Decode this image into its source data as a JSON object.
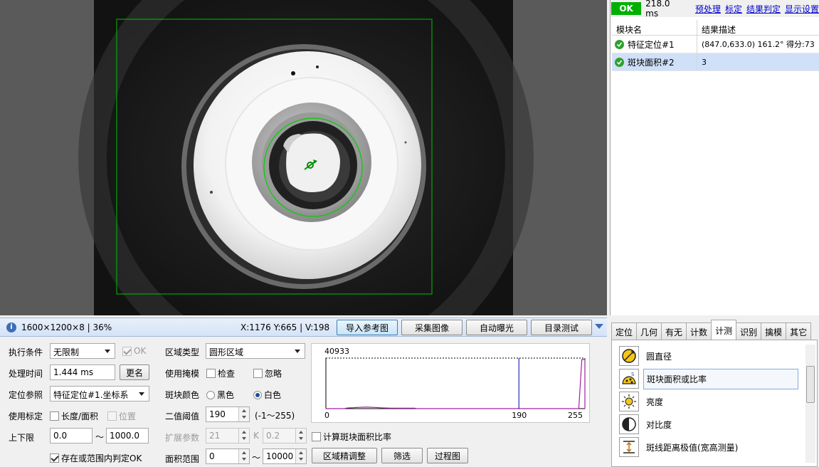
{
  "status": {
    "ok_label": "OK",
    "time": "218.0 ms",
    "menu": [
      "预处理",
      "标定",
      "结果判定",
      "显示设置"
    ]
  },
  "results": {
    "headers": [
      "模块名",
      "结果描述"
    ],
    "rows": [
      {
        "name": "特征定位#1",
        "desc": "(847.0,633.0) 161.2° 得分:73"
      },
      {
        "name": "斑块面积#2",
        "desc": "3"
      }
    ]
  },
  "image_bar": {
    "image_info": "1600×1200×8 | 36%",
    "pixel_info": "X:1176 Y:665 | V:198",
    "buttons": [
      "导入参考图",
      "采集图像",
      "自动曝光",
      "目录测试"
    ]
  },
  "params": {
    "exec_cond_label": "执行条件",
    "exec_cond_value": "无限制",
    "ok_label": "OK",
    "proc_time_label": "处理时间",
    "proc_time_value": "1.444 ms",
    "rename_label": "更名",
    "loc_ref_label": "定位参照",
    "loc_ref_value": "特征定位#1.坐标系",
    "use_calib_label": "使用标定",
    "length_area_label": "长度/面积",
    "position_label": "位置",
    "limits_label": "上下限",
    "lower_value": "0.0",
    "tilde": "～",
    "upper_value": "1000.0",
    "exist_ok_label": "存在或范围内判定OK",
    "region_type_label": "区域类型",
    "region_type_value": "圆形区域",
    "use_mask_label": "使用掩模",
    "check_label": "检查",
    "ignore_label": "忽略",
    "blob_color_label": "斑块颜色",
    "black_label": "黑色",
    "white_label": "白色",
    "threshold_label": "二值阈值",
    "threshold_value": "190",
    "threshold_range": "(-1～255)",
    "expand_label": "扩展参数",
    "expand_value": "21",
    "k_label": "K",
    "k_value": "0.2",
    "calc_ratio_label": "计算斑块面积比率",
    "area_range_label": "面积范围",
    "area_min": "0",
    "area_tilde": "～",
    "area_max": "10000",
    "region_adjust_label": "区域精调整",
    "filter_label": "筛选",
    "process_label": "过程图"
  },
  "histogram": {
    "max_label": "40933",
    "tick_labels": [
      "0",
      "190",
      "255"
    ],
    "threshold": 190,
    "x_max": 255
  },
  "tool_tabs": [
    "定位",
    "几何",
    "有无",
    "计数",
    "计测",
    "识别",
    "擒模",
    "其它"
  ],
  "tools": [
    "圆直径",
    "斑块面积或比率",
    "亮度",
    "对比度",
    "斑线距离极值(宽高测量)"
  ],
  "colors": {
    "ok_green": "#00b000",
    "overlay_green": "#00c000",
    "selected_row": "#cfe0f8",
    "link": "#0000cc",
    "histogram_line": "#0000aa",
    "histogram_curve": "#a020a0"
  }
}
